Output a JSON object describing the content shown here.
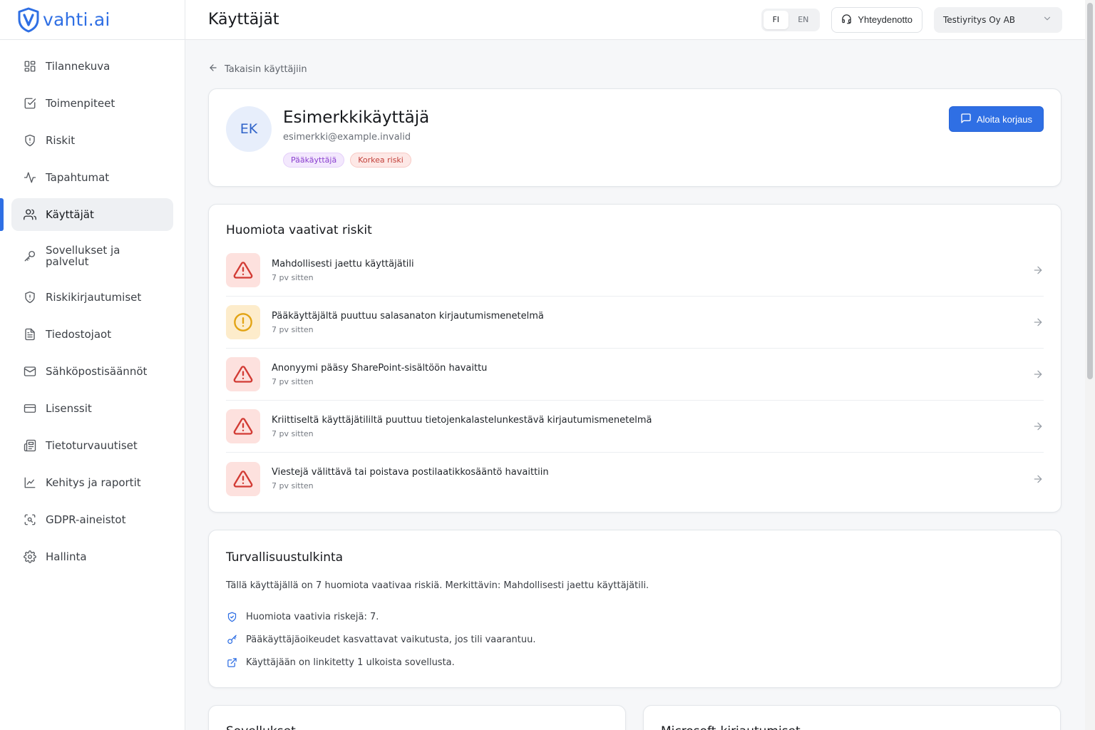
{
  "brand": {
    "name": "vahti.ai",
    "accent": "#2f6fe4"
  },
  "sidebar": {
    "items": [
      {
        "label": "Tilannekuva",
        "icon": "dashboard-icon"
      },
      {
        "label": "Toimenpiteet",
        "icon": "checkbox-icon"
      },
      {
        "label": "Riskit",
        "icon": "shield-alert-icon"
      },
      {
        "label": "Tapahtumat",
        "icon": "activity-icon"
      },
      {
        "label": "Käyttäjät",
        "icon": "users-icon",
        "active": true
      },
      {
        "label": "Sovellukset ja palvelut",
        "icon": "key-icon"
      },
      {
        "label": "Riskikirjautumiset",
        "icon": "shield-alert-icon"
      },
      {
        "label": "Tiedostojaot",
        "icon": "file-icon"
      },
      {
        "label": "Sähköpostisäännöt",
        "icon": "mail-icon"
      },
      {
        "label": "Lisenssit",
        "icon": "credit-card-icon"
      },
      {
        "label": "Tietoturvauutiset",
        "icon": "newspaper-icon"
      },
      {
        "label": "Kehitys ja raportit",
        "icon": "line-chart-icon"
      },
      {
        "label": "GDPR-aineistot",
        "icon": "scan-icon"
      },
      {
        "label": "Hallinta",
        "icon": "gear-icon"
      }
    ]
  },
  "header": {
    "title": "Käyttäjät",
    "languages": [
      "FI",
      "EN"
    ],
    "active_language": "FI",
    "contact_label": "Yhteydenotto",
    "organization": "Testiyritys Oy AB"
  },
  "main": {
    "back_label": "Takaisin käyttäjiin",
    "user": {
      "initials": "EK",
      "name": "Esimerkkikäyttäjä",
      "email": "esimerkki@example.invalid",
      "badges": [
        "Pääkäyttäjä",
        "Korkea riski"
      ]
    },
    "start_fix_label": "Aloita korjaus",
    "risks": {
      "title": "Huomiota vaativat riskit",
      "items": [
        {
          "title": "Mahdollisesti jaettu käyttäjätili",
          "time": "7 pv sitten",
          "severity": "high"
        },
        {
          "title": "Pääkäyttäjältä puuttuu salasanaton kirjautumismenetelmä",
          "time": "7 pv sitten",
          "severity": "medium"
        },
        {
          "title": "Anonyymi pääsy SharePoint-sisältöön havaittu",
          "time": "7 pv sitten",
          "severity": "high"
        },
        {
          "title": "Kriittiseltä käyttäjätililtä puuttuu tietojenkalastelunkestävä kirjautumismenetelmä",
          "time": "7 pv sitten",
          "severity": "high"
        },
        {
          "title": "Viestejä välittävä tai poistava postilaatikkosääntö havaittiin",
          "time": "7 pv sitten",
          "severity": "high"
        }
      ]
    },
    "summary": {
      "title": "Turvallisuustulkinta",
      "text": "Tällä käyttäjällä on 7 huomiota vaativaa riskiä. Merkittävin: Mahdollisesti jaettu käyttäjätili.",
      "items": [
        {
          "text": "Huomiota vaativia riskejä: 7.",
          "icon": "shield-check-icon"
        },
        {
          "text": "Pääkäyttäjäoikeudet kasvattavat vaikutusta, jos tili vaarantuu.",
          "icon": "key-icon"
        },
        {
          "text": "Käyttäjään on linkitetty 1 ulkoista sovellusta.",
          "icon": "external-link-icon"
        }
      ]
    },
    "bottom_cards": [
      "Sovellukset",
      "Microsoft-kirjautumiset"
    ]
  },
  "colors": {
    "danger_bg": "#fde1de",
    "danger_fg": "#d23b34",
    "warn_bg": "#fdeccb",
    "warn_fg": "#e2a313"
  }
}
